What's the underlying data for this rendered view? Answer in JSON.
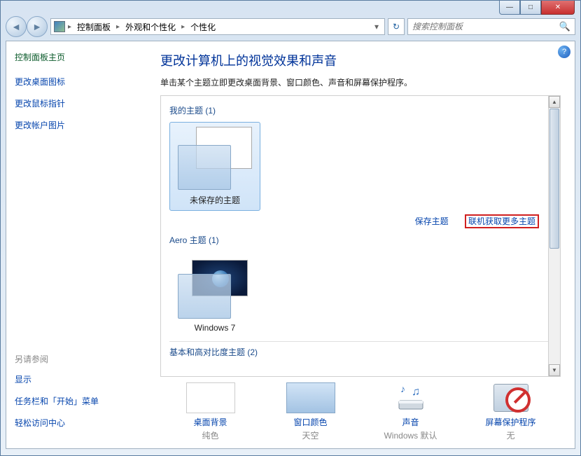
{
  "breadcrumb": {
    "items": [
      "控制面板",
      "外观和个性化",
      "个性化"
    ]
  },
  "search": {
    "placeholder": "搜索控制面板"
  },
  "sidebar": {
    "home": "控制面板主页",
    "links": [
      "更改桌面图标",
      "更改鼠标指针",
      "更改帐户图片"
    ],
    "see_also_label": "另请参阅",
    "see_also": [
      "显示",
      "任务栏和「开始」菜单",
      "轻松访问中心"
    ]
  },
  "main": {
    "title": "更改计算机上的视觉效果和声音",
    "subtitle": "单击某个主题立即更改桌面背景、窗口颜色、声音和屏幕保护程序。"
  },
  "groups": {
    "my_themes": {
      "label": "我的主题 (1)",
      "items": [
        {
          "name": "未保存的主题"
        }
      ]
    },
    "aero": {
      "label": "Aero 主题 (1)",
      "items": [
        {
          "name": "Windows 7"
        }
      ]
    },
    "basic": {
      "label": "基本和高对比度主题 (2)"
    }
  },
  "actions": {
    "save_theme": "保存主题",
    "get_more": "联机获取更多主题"
  },
  "options": {
    "bg": {
      "label": "桌面背景",
      "value": "纯色"
    },
    "color": {
      "label": "窗口颜色",
      "value": "天空"
    },
    "sound": {
      "label": "声音",
      "value": "Windows 默认"
    },
    "saver": {
      "label": "屏幕保护程序",
      "value": "无"
    }
  }
}
